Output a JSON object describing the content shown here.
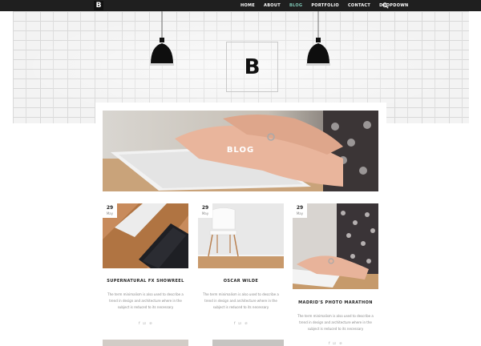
{
  "nav": {
    "logo": "B",
    "menu": [
      {
        "label": "HOME"
      },
      {
        "label": "ABOUT"
      },
      {
        "label": "BLOG"
      },
      {
        "label": "PORTFOLIO"
      },
      {
        "label": "CONTACT"
      },
      {
        "label": "DROPDOWN"
      }
    ],
    "active_index": 2,
    "search_icon": "search-icon"
  },
  "hero": {
    "logo": "B",
    "lamp_icon": "pendant-lamp"
  },
  "banner": {
    "title": "BLOG"
  },
  "posts": [
    {
      "day": "29",
      "month": "May",
      "title": "SUPERNATURAL FX SHOWREEL",
      "excerpt": [
        "The term minimalism is also used to describe a",
        "trend in design and architecture where in the",
        "subject is reduced to its necessary"
      ],
      "social": [
        "f",
        "☑",
        "℗"
      ]
    },
    {
      "day": "29",
      "month": "May",
      "title": "OSCAR WILDE",
      "excerpt": [
        "The term minimalism is also used to describe a",
        "trend in design and architecture where in the",
        "subject is reduced to its necessary"
      ],
      "social": [
        "f",
        "☑",
        "℗"
      ]
    },
    {
      "day": "29",
      "month": "May",
      "title": "MADRID'S PHOTO MARATHON",
      "excerpt": [
        "The term minimalism is also used to describe a",
        "trend in design and architecture where in the",
        "subject is reduced to its necessary"
      ],
      "social": [
        "f",
        "☑",
        "℗"
      ]
    }
  ],
  "colors": {
    "nav_bg": "#1f1f1f",
    "accent": "#7fc7b6",
    "text_dark": "#222222",
    "text_muted": "#888888"
  }
}
